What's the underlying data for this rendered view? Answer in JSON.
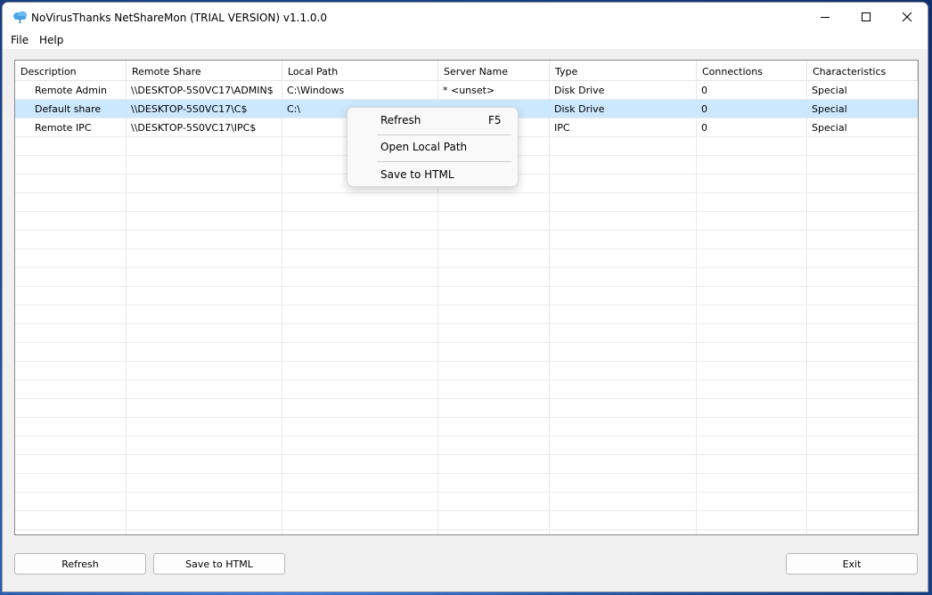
{
  "window": {
    "title": "NoVirusThanks NetShareMon (TRIAL VERSION) v1.1.0.0"
  },
  "menu": {
    "file": "File",
    "help": "Help"
  },
  "table": {
    "columns": [
      "Description",
      "Remote Share",
      "Local Path",
      "Server Name",
      "Type",
      "Connections",
      "Characteristics"
    ],
    "rows": [
      [
        "Remote Admin",
        "\\\\DESKTOP-5S0VC17\\ADMIN$",
        "C:\\Windows",
        "* <unset>",
        "Disk Drive",
        "0",
        "Special"
      ],
      [
        "Default share",
        "\\\\DESKTOP-5S0VC17\\C$",
        "C:\\",
        "",
        "Disk Drive",
        "0",
        "Special"
      ],
      [
        "Remote IPC",
        "\\\\DESKTOP-5S0VC17\\IPC$",
        "",
        "",
        "IPC",
        "0",
        "Special"
      ]
    ],
    "selected_row": 1
  },
  "context_menu": {
    "items": [
      {
        "label": "Refresh",
        "shortcut": "F5"
      },
      {
        "label": "Open Local Path",
        "shortcut": ""
      },
      {
        "label": "Save to HTML",
        "shortcut": ""
      }
    ]
  },
  "buttons": {
    "refresh": "Refresh",
    "save_html": "Save to HTML",
    "exit": "Exit"
  },
  "icons": {
    "app": "cloud-icon",
    "minimize": "minimize-icon",
    "maximize": "maximize-icon",
    "close": "close-icon"
  },
  "colors": {
    "selection": "#cce8ff",
    "app_icon": "#4aa3e8"
  }
}
